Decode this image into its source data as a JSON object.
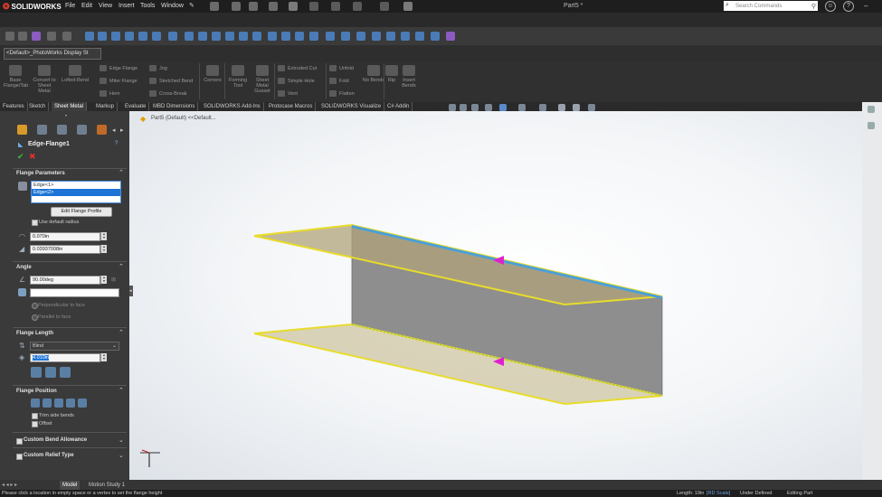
{
  "app": {
    "name": "SOLIDWORKS",
    "document": "Part5 *"
  },
  "menu": [
    "File",
    "Edit",
    "View",
    "Insert",
    "Tools",
    "Window"
  ],
  "search": {
    "placeholder": "Search Commands"
  },
  "config_select": "<Default>_PhotoWorks Display St",
  "command_manager": {
    "big": [
      "Base Flange/Tab",
      "Convert to Sheet Metal",
      "Lofted-Bend",
      "Corners",
      "Forming Tool",
      "Sheet Metal Gusset",
      "Unfold",
      "Fold",
      "Flatten",
      "No Bends",
      "Rip",
      "Insert Bends"
    ],
    "small": [
      "Edge Flange",
      "Miter Flange",
      "Hem",
      "Jog",
      "Sketched Bend",
      "Cross-Break",
      "Extruded Cut",
      "Simple Hole",
      "Vent"
    ]
  },
  "tabs": [
    "Features",
    "Sketch",
    "Sheet Metal",
    "Markup",
    "Evaluate",
    "MBD Dimensions",
    "SOLIDWORKS Add-Ins",
    "Protocase Macros",
    "SOLIDWORKS Visualize",
    "C# Addin"
  ],
  "active_tab": "Sheet Metal",
  "breadcrumb": "Part5 (Default) <<Default...",
  "property_manager": {
    "title": "Edge-Flange1",
    "flange_parameters": {
      "header": "Flange Parameters",
      "edges": [
        "Edge<1>",
        "Edge<2>"
      ],
      "edit_profile_button": "Edit Flange Profile",
      "use_default_radius": "Use default radius",
      "radius": "0.070in",
      "gap": "0.03937008in"
    },
    "angle": {
      "header": "Angle",
      "value": "90.00deg",
      "face_select": "",
      "perpendicular": "Perpendicular to face",
      "parallel": "Parallel to face"
    },
    "flange_length": {
      "header": "Flange Length",
      "end_condition": "Blind",
      "length": "4.010in"
    },
    "flange_position": {
      "header": "Flange Position",
      "trim_side_bends": "Trim side bends",
      "offset": "Offset"
    },
    "custom_bend_allowance": "Custom Bend Allowance",
    "custom_relief_type": "Custom Relief Type"
  },
  "bottom_tabs": [
    "Model",
    "Motion Study 1"
  ],
  "status": {
    "message": "Please click a location in empty space or a vertex to set the flange height",
    "length_prefix": "Length: 19in",
    "length_link": "[RD Scale]",
    "state": "Under Defined",
    "mode": "Editing Part"
  },
  "colors": {
    "accent": "#e23c2d",
    "selection": "#1e74d6",
    "flange_edge": "#e8dc2a",
    "flange_fill": "#b0a37a",
    "web": "#8e8e8e"
  }
}
